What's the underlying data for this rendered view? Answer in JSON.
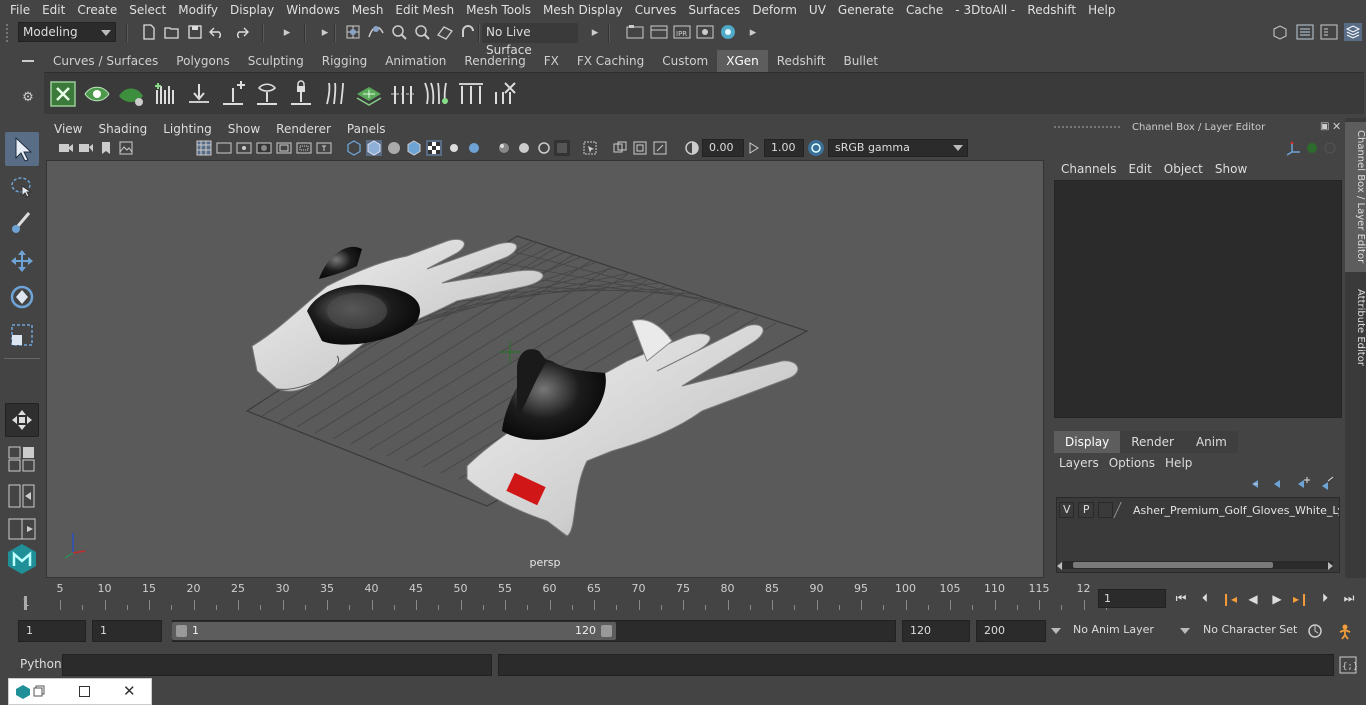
{
  "menubar": [
    "File",
    "Edit",
    "Create",
    "Select",
    "Modify",
    "Display",
    "Windows",
    "Mesh",
    "Edit Mesh",
    "Mesh Tools",
    "Mesh Display",
    "Curves",
    "Surfaces",
    "Deform",
    "UV",
    "Generate",
    "Cache",
    "- 3DtoAll -",
    "Redshift",
    "Help"
  ],
  "status": {
    "mode": "Modeling",
    "live_surface": "No Live Surface"
  },
  "shelf": {
    "tabs": [
      "Curves / Surfaces",
      "Polygons",
      "Sculpting",
      "Rigging",
      "Animation",
      "Rendering",
      "FX",
      "FX Caching",
      "Custom",
      "XGen",
      "Redshift",
      "Bullet"
    ],
    "active_tab": "XGen"
  },
  "viewport": {
    "menu": [
      "View",
      "Shading",
      "Lighting",
      "Show",
      "Renderer",
      "Panels"
    ],
    "exposure": "0.00",
    "gamma": "1.00",
    "color_space": "sRGB gamma",
    "camera_label": "persp"
  },
  "right_panel": {
    "title": "Channel Box / Layer Editor",
    "menu": [
      "Channels",
      "Edit",
      "Object",
      "Show"
    ],
    "layer_tabs": [
      "Display",
      "Render",
      "Anim"
    ],
    "active_layer_tab": "Display",
    "layer_menu": [
      "Layers",
      "Options",
      "Help"
    ],
    "layer": {
      "v": "V",
      "p": "P",
      "name": "Asher_Premium_Golf_Gloves_White_Lyi"
    },
    "side_tabs": [
      "Channel Box / Layer Editor",
      "Attribute Editor"
    ]
  },
  "timeline": {
    "ticks": [
      "5",
      "10",
      "15",
      "20",
      "25",
      "30",
      "35",
      "40",
      "45",
      "50",
      "55",
      "60",
      "65",
      "70",
      "75",
      "80",
      "85",
      "90",
      "95",
      "100",
      "105",
      "110",
      "115",
      "12"
    ],
    "start_mark": "1",
    "current_frame": "1"
  },
  "range": {
    "start": "1",
    "playback_start": "1",
    "slider_start": "1",
    "slider_end": "120",
    "playback_end": "120",
    "end": "200",
    "anim_layer": "No Anim Layer",
    "character_set": "No Character Set"
  },
  "command": {
    "label": "Python"
  },
  "colors": {
    "accent": "#5a6d86",
    "background": "#444444",
    "viewport": "#5a5a5a",
    "field": "#2b2b2b",
    "active_tab": "#5d5d5d"
  }
}
